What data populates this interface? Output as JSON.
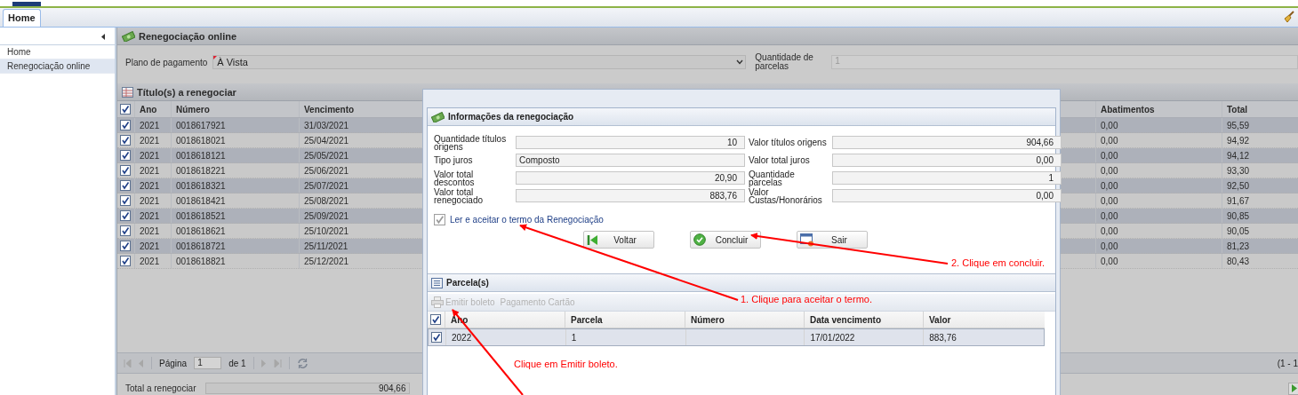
{
  "tabs": [
    {
      "label": "Home",
      "selected": true
    }
  ],
  "sidebar": {
    "items": [
      {
        "label": "Home",
        "selected": false
      },
      {
        "label": "Renegociação online",
        "selected": true
      }
    ]
  },
  "main": {
    "title": "Renegociação online",
    "plan_label": "Plano de pagamento",
    "plan_value": "À Vista",
    "qty_label": "Quantidade de parcelas",
    "qty_value": "1"
  },
  "titles_grid": {
    "title": "Título(s) a renegociar",
    "all_checked": true,
    "columns": [
      "Ano",
      "Número",
      "Vencimento",
      "Abatimentos",
      "Total"
    ],
    "rows": [
      {
        "checked": true,
        "ano": "2021",
        "numero": "0018617921",
        "vencimento": "31/03/2021",
        "abatimentos": "0,00",
        "total": "95,59"
      },
      {
        "checked": true,
        "ano": "2021",
        "numero": "0018618021",
        "vencimento": "25/04/2021",
        "abatimentos": "0,00",
        "total": "94,92"
      },
      {
        "checked": true,
        "ano": "2021",
        "numero": "0018618121",
        "vencimento": "25/05/2021",
        "abatimentos": "0,00",
        "total": "94,12"
      },
      {
        "checked": true,
        "ano": "2021",
        "numero": "0018618221",
        "vencimento": "25/06/2021",
        "abatimentos": "0,00",
        "total": "93,30"
      },
      {
        "checked": true,
        "ano": "2021",
        "numero": "0018618321",
        "vencimento": "25/07/2021",
        "abatimentos": "0,00",
        "total": "92,50"
      },
      {
        "checked": true,
        "ano": "2021",
        "numero": "0018618421",
        "vencimento": "25/08/2021",
        "abatimentos": "0,00",
        "total": "91,67"
      },
      {
        "checked": true,
        "ano": "2021",
        "numero": "0018618521",
        "vencimento": "25/09/2021",
        "abatimentos": "0,00",
        "total": "90,85"
      },
      {
        "checked": true,
        "ano": "2021",
        "numero": "0018618621",
        "vencimento": "25/10/2021",
        "abatimentos": "0,00",
        "total": "90,05"
      },
      {
        "checked": true,
        "ano": "2021",
        "numero": "0018618721",
        "vencimento": "25/11/2021",
        "abatimentos": "0,00",
        "total": "81,23"
      },
      {
        "checked": true,
        "ano": "2021",
        "numero": "0018618821",
        "vencimento": "25/12/2021",
        "abatimentos": "0,00",
        "total": "80,43"
      }
    ],
    "pager": {
      "page_label": "Página",
      "page_value": "1",
      "of_label": "de 1",
      "range": "(1 - 1"
    }
  },
  "total": {
    "label": "Total a renegociar",
    "value": "904,66"
  },
  "modal": {
    "info_title": "Informações da renegociação",
    "fields": [
      {
        "label": "Quantidade títulos origens",
        "value": "10",
        "kind": "number"
      },
      {
        "label": "Valor títulos origens",
        "value": "904,66",
        "kind": "number"
      },
      {
        "label": "Tipo juros",
        "value": "Composto",
        "kind": "text"
      },
      {
        "label": "Valor total juros",
        "value": "0,00",
        "kind": "number"
      },
      {
        "label": "Valor total descontos",
        "value": "20,90",
        "kind": "number"
      },
      {
        "label": "Quantidade parcelas",
        "value": "1",
        "kind": "number"
      },
      {
        "label": "Valor total renegociado",
        "value": "883,76",
        "kind": "number"
      },
      {
        "label": "Valor Custas/Honorários",
        "value": "0,00",
        "kind": "number"
      }
    ],
    "accept": {
      "label": "Ler e aceitar o termo da Renegociação",
      "checked": true
    },
    "buttons": [
      {
        "label": "Voltar",
        "kind": "back"
      },
      {
        "label": "Concluir",
        "kind": "confirm"
      },
      {
        "label": "Sair",
        "kind": "exit"
      }
    ],
    "parcelas": {
      "title": "Parcela(s)",
      "toolbar": [
        {
          "label": "Emitir boleto",
          "kind": "print",
          "disabled": true
        },
        {
          "label": "Pagamento Cartão",
          "kind": "plain",
          "disabled": true
        }
      ],
      "all_checked": true,
      "columns": [
        "Ano",
        "Parcela",
        "Número",
        "Data vencimento",
        "Valor"
      ],
      "rows": [
        {
          "checked": true,
          "selected": true,
          "ano": "2022",
          "parcela": "1",
          "data": "17/01/2022",
          "valor": "883,76"
        }
      ]
    }
  },
  "annotations": [
    {
      "text": "1. Clique para aceitar o termo.",
      "kind": "accept"
    },
    {
      "text": "2. Clique em concluir.",
      "kind": "confirm"
    },
    {
      "text": "Clique em Emitir boleto.",
      "kind": "print"
    }
  ]
}
